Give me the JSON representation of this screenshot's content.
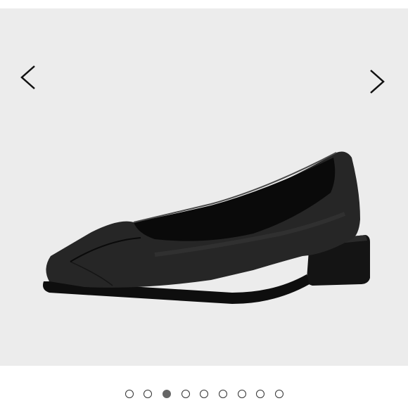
{
  "carousel": {
    "prev_icon": "chevron-left-icon",
    "next_icon": "chevron-right-icon",
    "image": "black-leather-square-toe-flat-shoe",
    "slide_count": 9,
    "active_slide": 3
  },
  "colors": {
    "viewer_bg": "#ececec",
    "dot_active": "#666666",
    "dot_border": "#333333"
  }
}
